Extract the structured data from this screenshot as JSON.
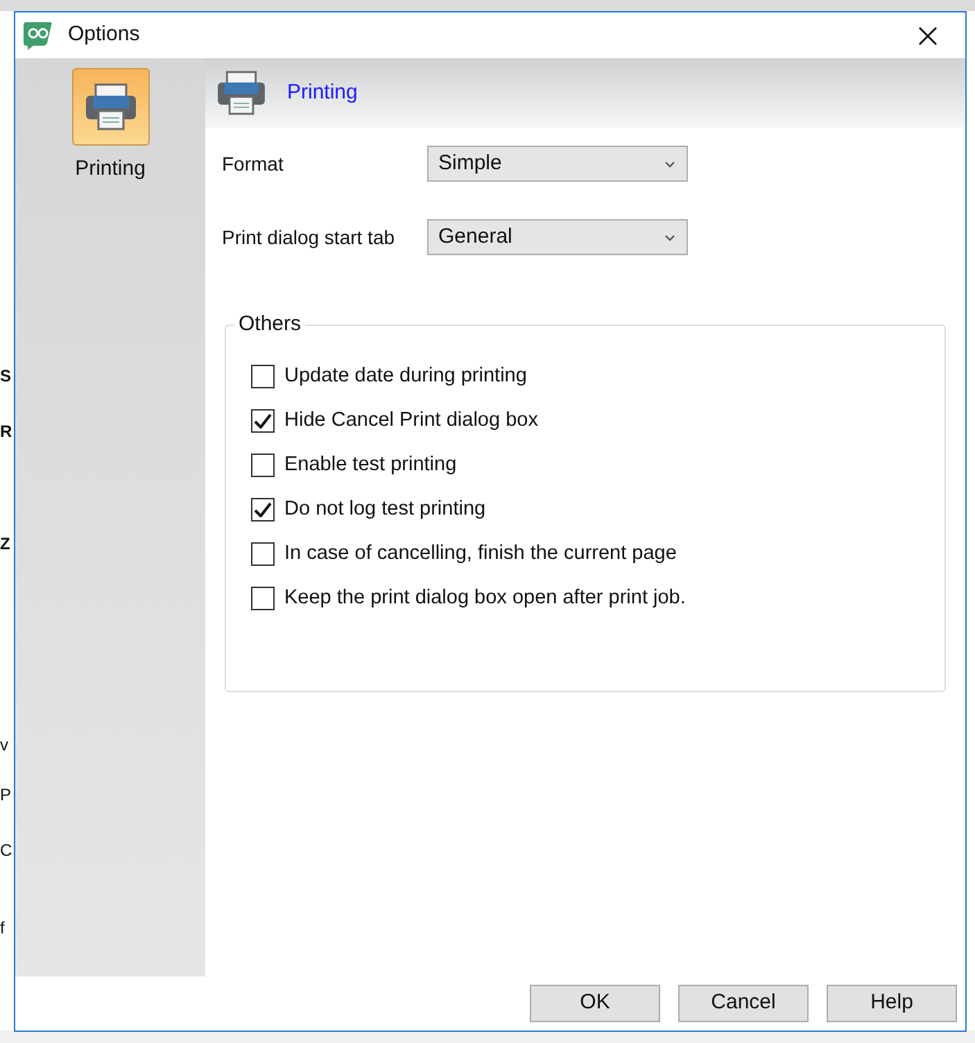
{
  "background_fragments": [
    "S",
    "R",
    "Z",
    "v",
    "P",
    "C",
    "f"
  ],
  "window": {
    "title": "Options"
  },
  "sidebar": {
    "items": [
      {
        "label": "Printing",
        "selected": true
      }
    ]
  },
  "header": {
    "title": "Printing"
  },
  "fields": [
    {
      "label": "Format",
      "value": "Simple"
    },
    {
      "label": "Print dialog start tab",
      "value": "General"
    }
  ],
  "group": {
    "title": "Others",
    "options": [
      {
        "label": "Update date during printing",
        "checked": false
      },
      {
        "label": "Hide Cancel Print dialog box",
        "checked": true
      },
      {
        "label": "Enable test printing",
        "checked": false
      },
      {
        "label": "Do not log test printing",
        "checked": true
      },
      {
        "label": "In case of cancelling, finish the current page",
        "checked": false
      },
      {
        "label": "Keep the print dialog box open after print job.",
        "checked": false
      }
    ]
  },
  "buttons": [
    "OK",
    "Cancel",
    "Help"
  ]
}
